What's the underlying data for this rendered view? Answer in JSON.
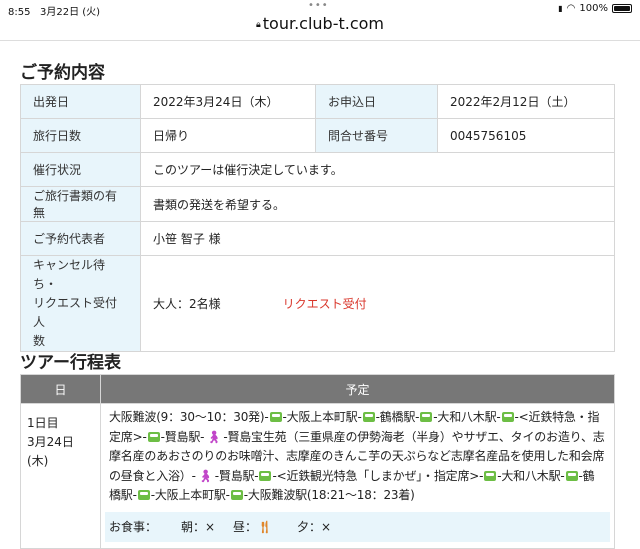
{
  "status": {
    "time": "8:55",
    "date": "3月22日 (火)",
    "battery": "100%"
  },
  "url": "tour.club-t.com",
  "reservation": {
    "title": "ご予約内容",
    "departure_label": "出発日",
    "departure_value": "2022年3月24日（木）",
    "apply_label": "お申込日",
    "apply_value": "2022年2月12日（土）",
    "days_label": "旅行日数",
    "days_value": "日帰り",
    "inquiry_label": "問合せ番号",
    "inquiry_value": "0045756105",
    "status_label": "催行状況",
    "status_value": "このツアーは催行決定しています。",
    "docs_label": "ご旅行書類の有無",
    "docs_value": "書類の発送を希望する。",
    "rep_label": "ご予約代表者",
    "rep_value": "小笹 智子 様",
    "cancel_label_1": "キャンセル待ち・",
    "cancel_label_2": "リクエスト受付人",
    "cancel_label_3": "数",
    "cancel_value": "大人：2名様",
    "cancel_status": "リクエスト受付"
  },
  "itinerary": {
    "title": "ツアー行程表",
    "col_day": "日",
    "col_plan": "予定",
    "day_1": "1日目",
    "day_2": "3月24日",
    "day_3": "(木)",
    "route": {
      "s1": "大阪難波(9：30〜10：30発)-",
      "s2": "-大阪上本町駅-",
      "s3": "-鶴橋駅-",
      "s4": "-大和八木駅-",
      "s5": "-<近鉄特急・指定席>-",
      "s6": "-賢島駅-",
      "s7": "-賢島宝生苑（三重県産の伊勢海老（半身）やサザエ、タイのお造り、志摩名産のあおさのりのお味噌汁、志摩産のきんこ芋の天ぷらなど志摩名産品を使用した和会席の昼食と入浴）-",
      "s8": "-賢島駅-",
      "s9": "-<近鉄観光特急「しまかぜ」・指定席>-",
      "s10": "-大和八木駅-",
      "s11": "-鶴橋駅-",
      "s12": "-大阪上本町駅-",
      "s13": "-大阪難波駅(18:21〜18：23着)"
    },
    "meals_label": "お食事：",
    "breakfast": "朝：×",
    "lunch": "昼：",
    "dinner": "夕：×"
  }
}
